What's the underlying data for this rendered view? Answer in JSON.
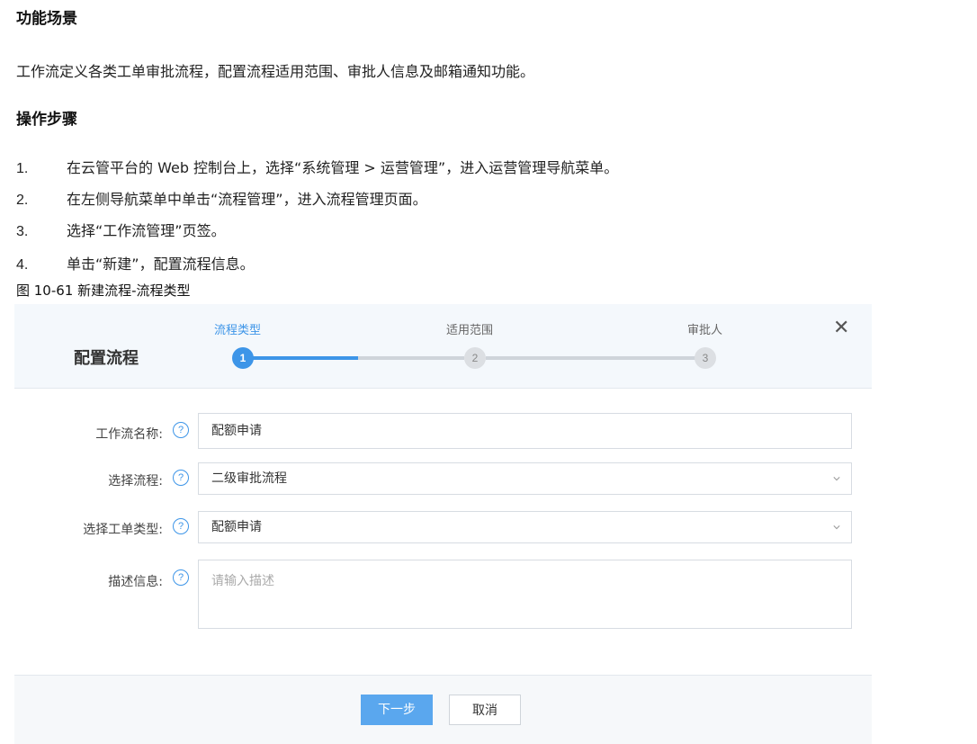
{
  "doc": {
    "h_scene": "功能场景",
    "scene_text": "工作流定义各类工单审批流程，配置流程适用范围、审批人信息及邮箱通知功能。",
    "h_steps": "操作步骤",
    "steps": [
      {
        "num": "1.",
        "text": "在云管平台的 Web 控制台上，选择“系统管理 > 运营管理”，进入运营管理导航菜单。"
      },
      {
        "num": "2.",
        "text": "在左侧导航菜单中单击“流程管理”，进入流程管理页面。"
      },
      {
        "num": "3.",
        "text": "选择“工作流管理”页签。"
      },
      {
        "num": "4.",
        "text": "单击“新建”，配置流程信息。"
      }
    ],
    "caption": "图 10-61 新建流程-流程类型"
  },
  "dialog": {
    "title": "配置流程",
    "close_glyph": "✕",
    "steps": [
      {
        "label": "流程类型",
        "num": "1"
      },
      {
        "label": "适用范围",
        "num": "2"
      },
      {
        "label": "审批人",
        "num": "3"
      }
    ],
    "fields": {
      "name_label": "工作流名称:",
      "name_value": "配额申请",
      "flow_label": "选择流程:",
      "flow_value": "二级审批流程",
      "type_label": "选择工单类型:",
      "type_value": "配额申请",
      "desc_label": "描述信息:",
      "desc_placeholder": "请输入描述"
    },
    "help_glyph": "?",
    "buttons": {
      "next": "下一步",
      "cancel": "取消"
    },
    "colors": {
      "accent": "#3d95e8",
      "inactive": "#cfd4da"
    }
  }
}
